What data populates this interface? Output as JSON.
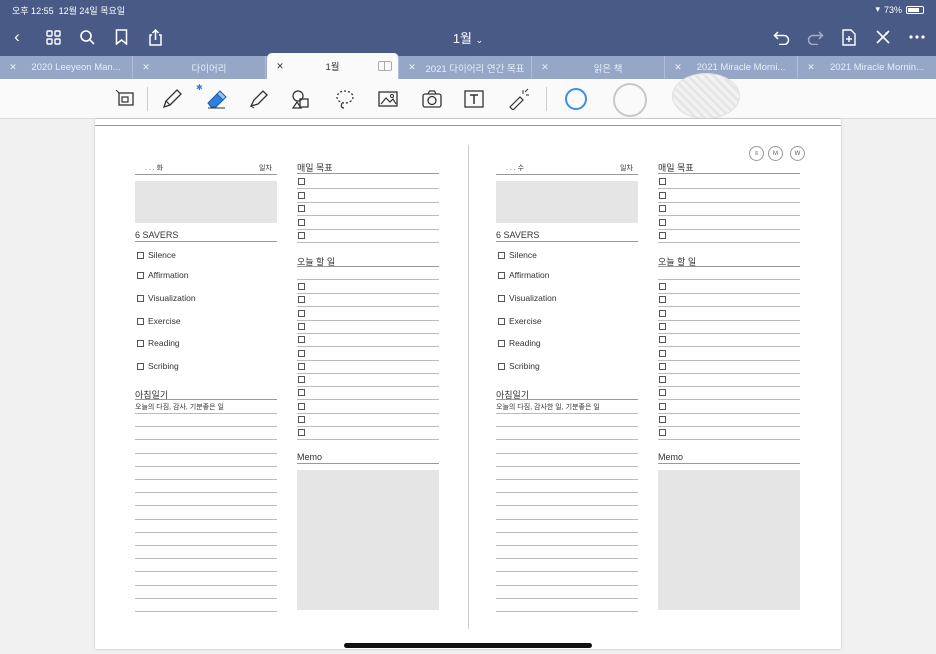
{
  "status": {
    "time": "오후 12:55",
    "date": "12월 24일 목요일",
    "battery": "73%"
  },
  "nav": {
    "title": "1월",
    "title_chevron": "⌄"
  },
  "tabs": [
    {
      "label": "2020 Leeyeon Man..."
    },
    {
      "label": "다이어리"
    },
    {
      "label": "1월",
      "active": true
    },
    {
      "label": "2021 다이어리 연간 목표"
    },
    {
      "label": "읽은 책"
    },
    {
      "label": "2021 Miracle Morni..."
    },
    {
      "label": "2021 Miracle Mornin..."
    }
  ],
  "toolbar": {
    "tools": [
      "zoom-icon",
      "pen-icon",
      "eraser-icon",
      "highlighter-icon",
      "shapes-icon",
      "lasso-icon",
      "image-icon",
      "camera-icon",
      "text-icon",
      "laser-pointer-icon"
    ],
    "colors": {
      "selected_ring": "#3b8fe0",
      "swatch_2": "#c8c8c8",
      "swatch_3": "#e0e0e0"
    }
  },
  "page": {
    "header_buttons": [
      "≡",
      "M",
      "W"
    ],
    "left": {
      "date_marks": ". . . 화",
      "day_label": "일차",
      "savers_title": "6 SAVERS",
      "savers": [
        "Silence",
        "Affirmation",
        "Visualization",
        "Exercise",
        "Reading",
        "Scribing"
      ],
      "journal_title": "아침일기",
      "journal_hint": "오늘의 다짐, 감사, 기분좋은 일",
      "goals_title": "매일 목표",
      "todo_title": "오늘 할 일",
      "memo_title": "Memo"
    },
    "right": {
      "date_marks": ". . . 수",
      "day_label": "일차",
      "savers_title": "6 SAVERS",
      "savers": [
        "Silence",
        "Affirmation",
        "Visualization",
        "Exercise",
        "Reading",
        "Scribing"
      ],
      "journal_title": "아침일기",
      "journal_hint": "오늘의 다짐, 감사한 일, 기분좋은 일",
      "goals_title": "매일 목표",
      "todo_title": "오늘 할 일",
      "memo_title": "Memo"
    }
  }
}
